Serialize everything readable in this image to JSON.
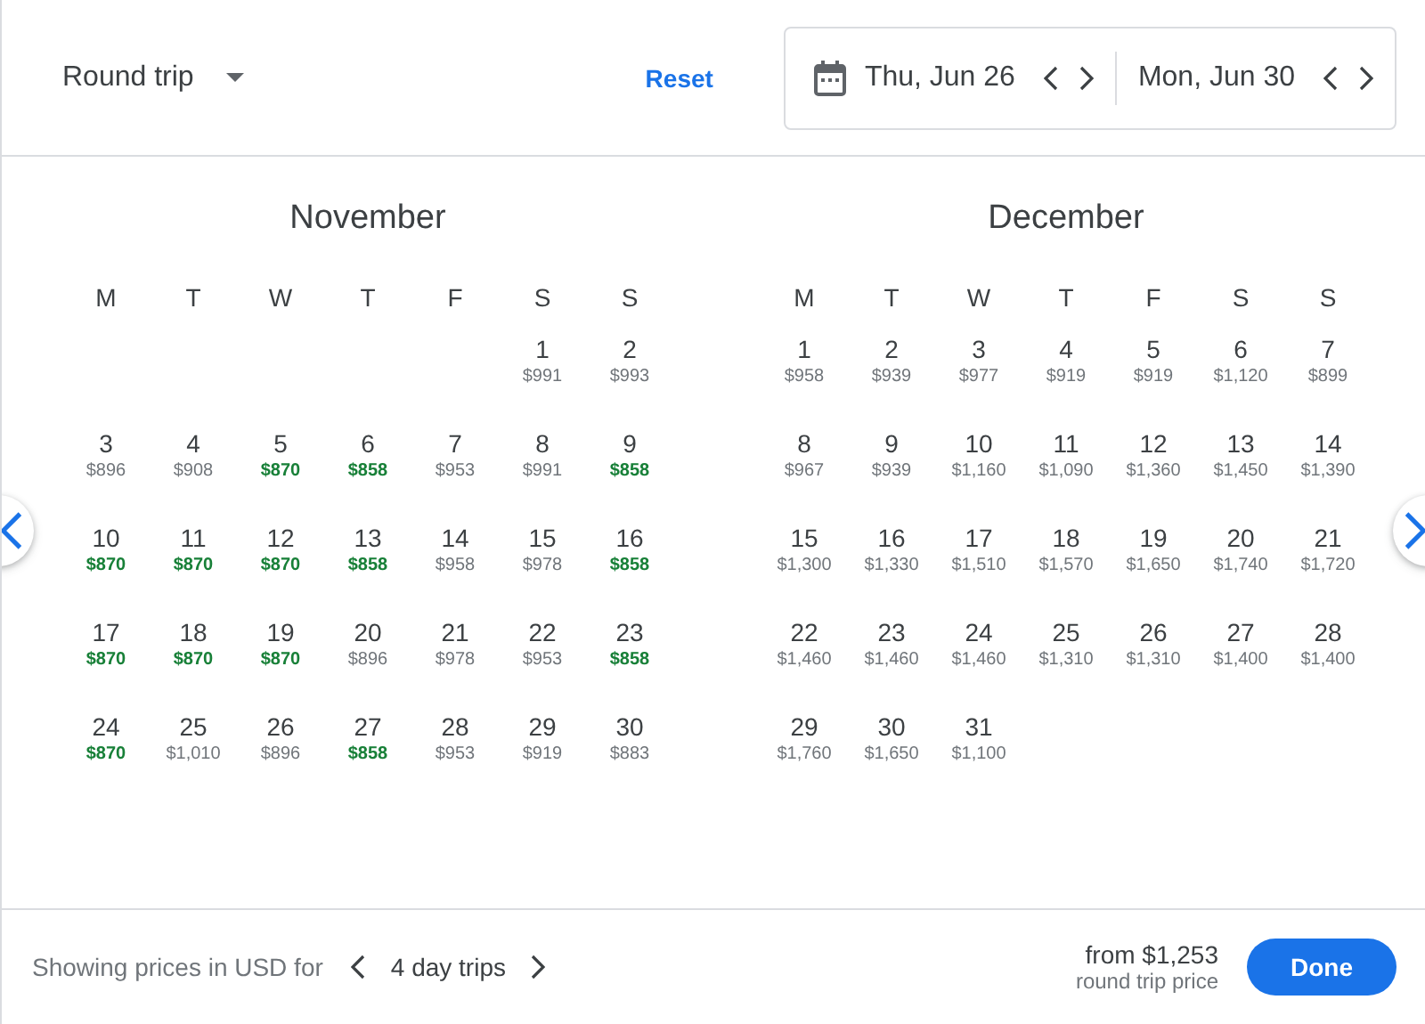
{
  "trip_type": {
    "label": "Round trip"
  },
  "reset": "Reset",
  "dates": [
    {
      "label": "Thu, Jun 26"
    },
    {
      "label": "Mon, Jun 30"
    }
  ],
  "months": [
    {
      "title": "November",
      "weekdays": [
        "M",
        "T",
        "W",
        "T",
        "F",
        "S",
        "S"
      ],
      "weeks": [
        [
          {
            "day": "1",
            "price": "$991",
            "low": false
          },
          {
            "day": "2",
            "price": "$993",
            "low": false
          }
        ],
        [
          {
            "day": "3",
            "price": "$896",
            "low": false
          },
          {
            "day": "4",
            "price": "$908",
            "low": false
          },
          {
            "day": "5",
            "price": "$870",
            "low": true
          },
          {
            "day": "6",
            "price": "$858",
            "low": true
          },
          {
            "day": "7",
            "price": "$953",
            "low": false
          },
          {
            "day": "8",
            "price": "$991",
            "low": false
          },
          {
            "day": "9",
            "price": "$858",
            "low": true
          }
        ],
        [
          {
            "day": "10",
            "price": "$870",
            "low": true
          },
          {
            "day": "11",
            "price": "$870",
            "low": true
          },
          {
            "day": "12",
            "price": "$870",
            "low": true
          },
          {
            "day": "13",
            "price": "$858",
            "low": true
          },
          {
            "day": "14",
            "price": "$958",
            "low": false
          },
          {
            "day": "15",
            "price": "$978",
            "low": false
          },
          {
            "day": "16",
            "price": "$858",
            "low": true
          }
        ],
        [
          {
            "day": "17",
            "price": "$870",
            "low": true
          },
          {
            "day": "18",
            "price": "$870",
            "low": true
          },
          {
            "day": "19",
            "price": "$870",
            "low": true
          },
          {
            "day": "20",
            "price": "$896",
            "low": false
          },
          {
            "day": "21",
            "price": "$978",
            "low": false
          },
          {
            "day": "22",
            "price": "$953",
            "low": false
          },
          {
            "day": "23",
            "price": "$858",
            "low": true
          }
        ],
        [
          {
            "day": "24",
            "price": "$870",
            "low": true
          },
          {
            "day": "25",
            "price": "$1,010",
            "low": false
          },
          {
            "day": "26",
            "price": "$896",
            "low": false
          },
          {
            "day": "27",
            "price": "$858",
            "low": true
          },
          {
            "day": "28",
            "price": "$953",
            "low": false
          },
          {
            "day": "29",
            "price": "$919",
            "low": false
          },
          {
            "day": "30",
            "price": "$883",
            "low": false
          }
        ]
      ]
    },
    {
      "title": "December",
      "weekdays": [
        "M",
        "T",
        "W",
        "T",
        "F",
        "S",
        "S"
      ],
      "weeks": [
        [
          {
            "day": "1",
            "price": "$958",
            "low": false
          },
          {
            "day": "2",
            "price": "$939",
            "low": false
          },
          {
            "day": "3",
            "price": "$977",
            "low": false
          },
          {
            "day": "4",
            "price": "$919",
            "low": false
          },
          {
            "day": "5",
            "price": "$919",
            "low": false
          },
          {
            "day": "6",
            "price": "$1,120",
            "low": false
          },
          {
            "day": "7",
            "price": "$899",
            "low": false
          }
        ],
        [
          {
            "day": "8",
            "price": "$967",
            "low": false
          },
          {
            "day": "9",
            "price": "$939",
            "low": false
          },
          {
            "day": "10",
            "price": "$1,160",
            "low": false
          },
          {
            "day": "11",
            "price": "$1,090",
            "low": false
          },
          {
            "day": "12",
            "price": "$1,360",
            "low": false
          },
          {
            "day": "13",
            "price": "$1,450",
            "low": false
          },
          {
            "day": "14",
            "price": "$1,390",
            "low": false
          }
        ],
        [
          {
            "day": "15",
            "price": "$1,300",
            "low": false
          },
          {
            "day": "16",
            "price": "$1,330",
            "low": false
          },
          {
            "day": "17",
            "price": "$1,510",
            "low": false
          },
          {
            "day": "18",
            "price": "$1,570",
            "low": false
          },
          {
            "day": "19",
            "price": "$1,650",
            "low": false
          },
          {
            "day": "20",
            "price": "$1,740",
            "low": false
          },
          {
            "day": "21",
            "price": "$1,720",
            "low": false
          }
        ],
        [
          {
            "day": "22",
            "price": "$1,460",
            "low": false
          },
          {
            "day": "23",
            "price": "$1,460",
            "low": false
          },
          {
            "day": "24",
            "price": "$1,460",
            "low": false
          },
          {
            "day": "25",
            "price": "$1,310",
            "low": false
          },
          {
            "day": "26",
            "price": "$1,310",
            "low": false
          },
          {
            "day": "27",
            "price": "$1,400",
            "low": false
          },
          {
            "day": "28",
            "price": "$1,400",
            "low": false
          }
        ],
        [
          {
            "day": "29",
            "price": "$1,760",
            "low": false
          },
          {
            "day": "30",
            "price": "$1,650",
            "low": false
          },
          {
            "day": "31",
            "price": "$1,100",
            "low": false
          }
        ]
      ]
    }
  ],
  "footer": {
    "caption": "Showing prices in USD for",
    "duration": "4 day trips",
    "price": "from $1,253",
    "price_note": "round trip price",
    "done": "Done"
  }
}
